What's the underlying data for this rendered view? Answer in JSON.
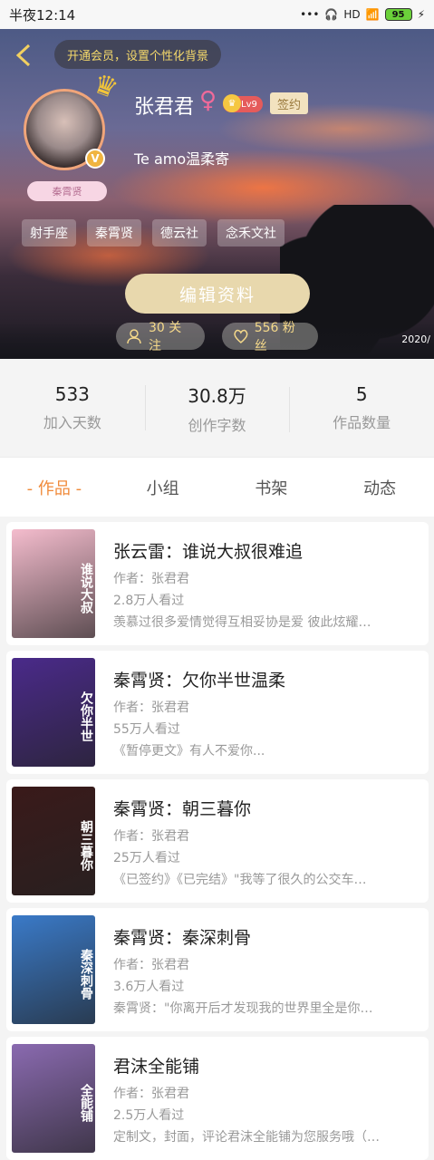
{
  "status_bar": {
    "time": "半夜12:14",
    "signal": "HD",
    "battery": "95"
  },
  "header": {
    "vip_prompt": "开通会员，设置个性化背景",
    "username": "张君君",
    "gender": "♀",
    "level": "Lv9",
    "signed": "签约",
    "avatar_ribbon": "秦霄贤",
    "verified": "V",
    "bio": "Te amo温柔寄",
    "tags": [
      "射手座",
      "秦霄贤",
      "德云社",
      "念禾文社"
    ],
    "edit_button": "编辑资料",
    "follow": "30 关注",
    "fans": "556 粉丝",
    "watermark": "2020/"
  },
  "stats": [
    {
      "value": "533",
      "label": "加入天数"
    },
    {
      "value": "30.8万",
      "label": "创作字数"
    },
    {
      "value": "5",
      "label": "作品数量"
    }
  ],
  "tabs": [
    "- 作品 -",
    "小组",
    "书架",
    "动态"
  ],
  "active_tab": 0,
  "works": [
    {
      "title": "张云雷：谁说大叔很难追",
      "author": "作者：张君君",
      "views": "2.8万人看过",
      "desc": "羡慕过很多爱情觉得互相妥协是爱 彼此炫耀…",
      "cover_color": "#f4bccd",
      "cover_text": "谁说大叔"
    },
    {
      "title": "秦霄贤：欠你半世温柔",
      "author": "作者：张君君",
      "views": "55万人看过",
      "desc": "《暂停更文》有人不爱你...",
      "cover_color": "#4a2a8a",
      "cover_text": "欠你半世"
    },
    {
      "title": "秦霄贤：朝三暮你",
      "author": "作者：张君君",
      "views": "25万人看过",
      "desc": "《已签约》《已完结》\"我等了很久的公交车…",
      "cover_color": "#3a1a1a",
      "cover_text": "朝三暮你"
    },
    {
      "title": "秦霄贤：秦深刺骨",
      "author": "作者：张君君",
      "views": "3.6万人看过",
      "desc": "秦霄贤：\"你离开后才发现我的世界里全是你…",
      "cover_color": "#3a7ac8",
      "cover_text": "秦深刺骨"
    },
    {
      "title": "君沫全能铺",
      "author": "作者：张君君",
      "views": "2.5万人看过",
      "desc": "定制文，封面，评论君沫全能铺为您服务哦（…",
      "cover_color": "#8a6ab0",
      "cover_text": "全能铺"
    }
  ]
}
